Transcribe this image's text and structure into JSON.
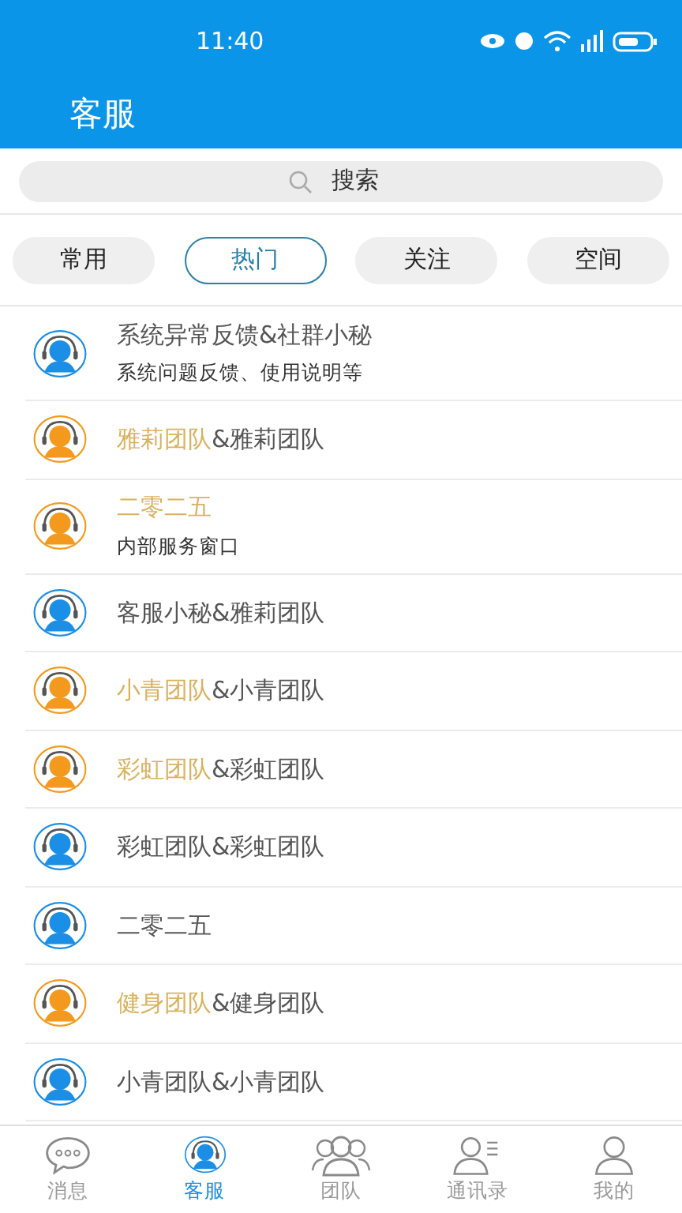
{
  "status_bar": {
    "time": "11:40"
  },
  "header": {
    "title": "客服"
  },
  "search": {
    "placeholder": "搜索"
  },
  "filters": [
    {
      "label": "常用",
      "selected": false
    },
    {
      "label": "热门",
      "selected": true
    },
    {
      "label": "关注",
      "selected": false
    },
    {
      "label": "空间",
      "selected": false
    }
  ],
  "contacts": [
    {
      "title": "系统异常反馈&社群小秘",
      "subtitle": "系统问题反馈、使用说明等",
      "color": "#1b8ee6"
    },
    {
      "highlight": "雅莉团队",
      "title": "&雅莉团队",
      "color": "#f39a1e"
    },
    {
      "highlight": "二零二五",
      "subtitle": "内部服务窗口",
      "color": "#f39a1e"
    },
    {
      "title": "客服小秘&雅莉团队",
      "color": "#1b8ee6"
    },
    {
      "highlight": "小青团队",
      "title": "&小青团队",
      "color": "#f39a1e"
    },
    {
      "highlight": "彩虹团队",
      "title": "&彩虹团队",
      "color": "#f39a1e"
    },
    {
      "title": "彩虹团队&彩虹团队",
      "color": "#1b8ee6"
    },
    {
      "title": "二零二五",
      "color": "#1b8ee6"
    },
    {
      "highlight": "健身团队",
      "title": "&健身团队",
      "color": "#f39a1e"
    },
    {
      "title": "小青团队&小青团队",
      "color": "#1b8ee6"
    }
  ],
  "bottom_nav": [
    {
      "label": "消息",
      "kind": "chat",
      "selected": false
    },
    {
      "label": "客服",
      "kind": "agent",
      "selected": true
    },
    {
      "label": "团队",
      "kind": "team",
      "selected": false
    },
    {
      "label": "通讯录",
      "kind": "contacts",
      "selected": false
    },
    {
      "label": "我的",
      "kind": "me",
      "selected": false
    }
  ]
}
